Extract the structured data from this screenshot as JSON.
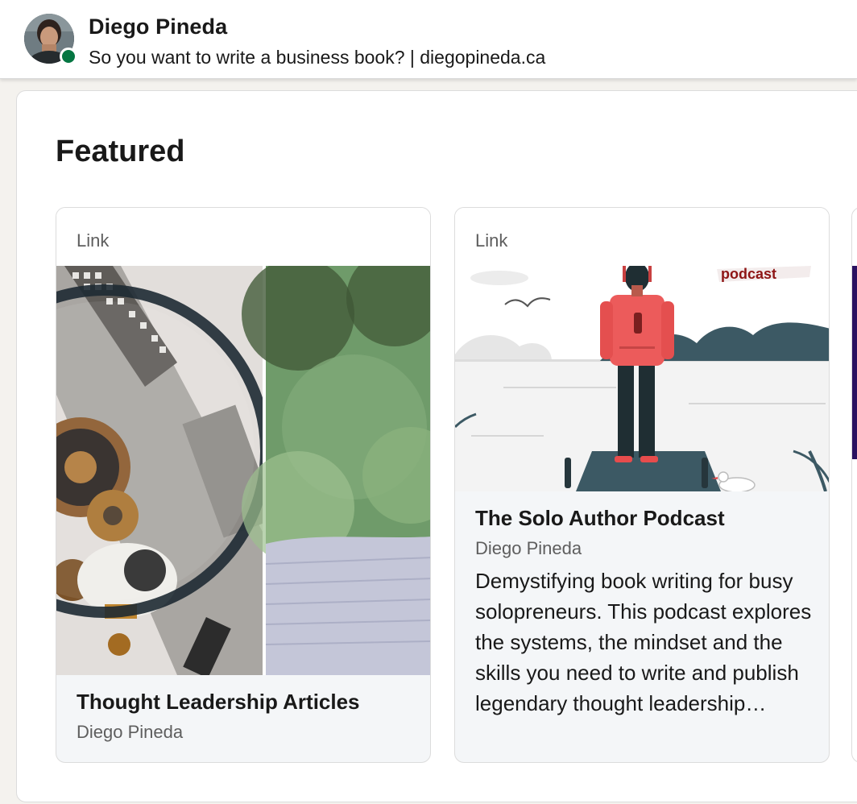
{
  "header": {
    "name": "Diego Pineda",
    "headline": "So you want to write a business book? | diegopineda.ca",
    "presence_color": "#057642"
  },
  "featured": {
    "title": "Featured",
    "cards": [
      {
        "type": "Link",
        "title": "Thought Leadership Articles",
        "author": "Diego Pineda",
        "image": "magnifying-glass-and-gears-collage"
      },
      {
        "type": "Link",
        "title": "The Solo Author Podcast",
        "author": "Diego Pineda",
        "description": "Demystifying book writing for busy solopreneurs. This podcast explores the systems, the mindset and the skills you need to write and publish legendary thought leadership…",
        "image": "person-on-dock-podcast-illustration",
        "image_text": "podcast"
      }
    ]
  }
}
